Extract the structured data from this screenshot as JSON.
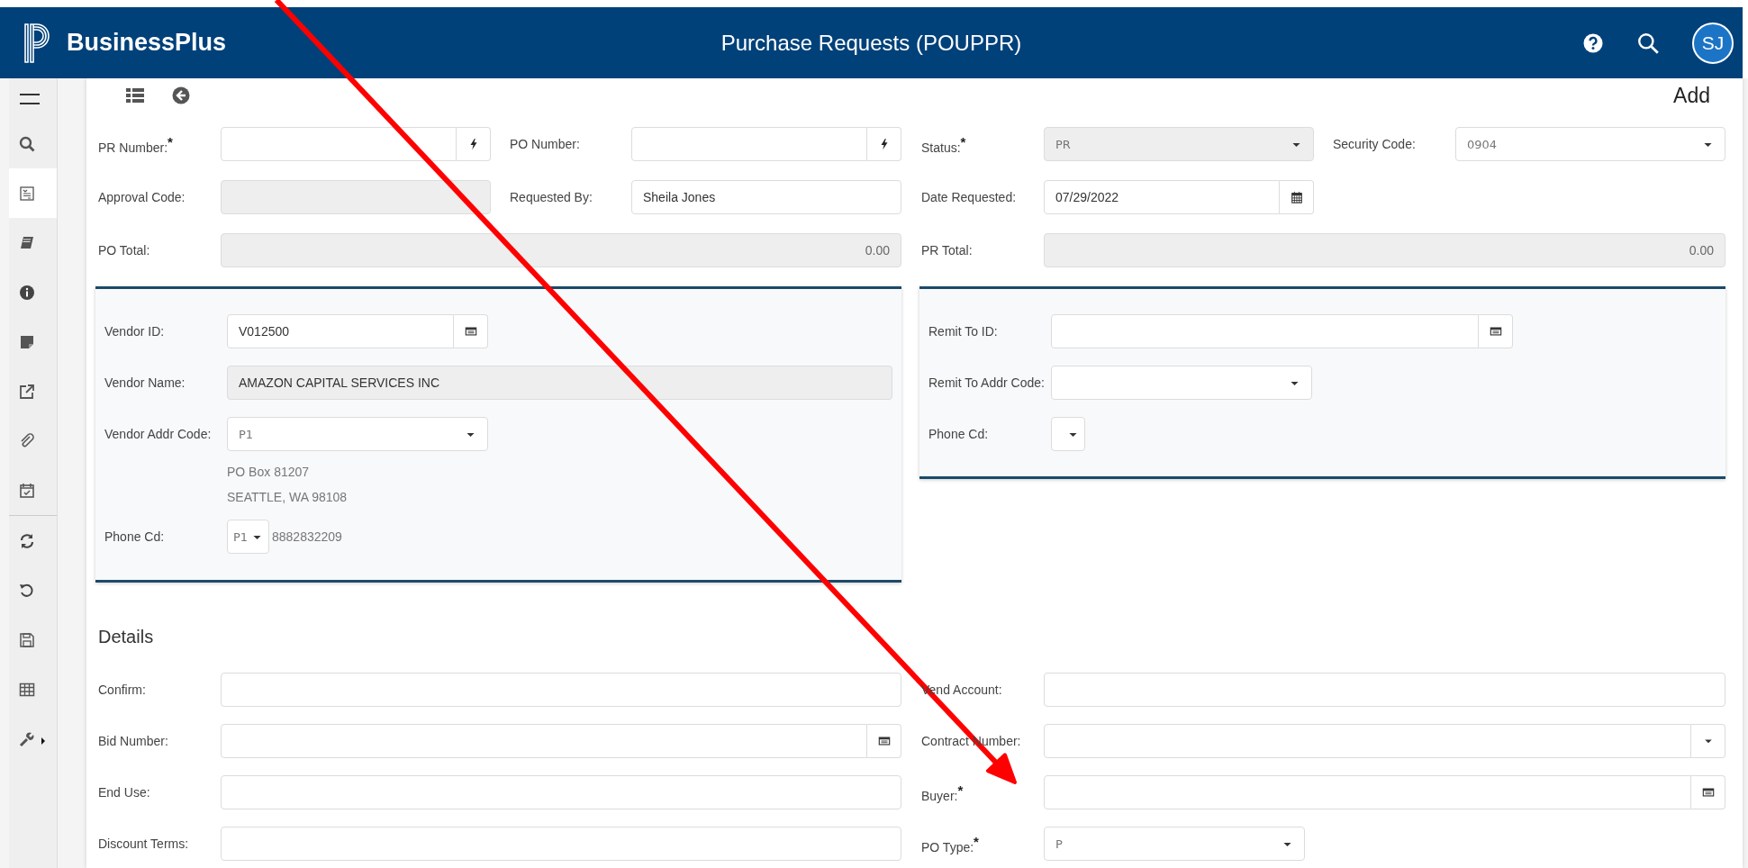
{
  "header": {
    "app_name": "BusinessPlus",
    "title": "Purchase Requests (POUPPR)",
    "avatar": "SJ"
  },
  "sidebar": {
    "groups": [
      [
        {
          "kind": "menu",
          "selected": false
        },
        {
          "kind": "search",
          "selected": false
        },
        {
          "kind": "form",
          "selected": true
        },
        {
          "kind": "book",
          "selected": false
        },
        {
          "kind": "info",
          "selected": false
        },
        {
          "kind": "note",
          "selected": false
        },
        {
          "kind": "external",
          "selected": false
        },
        {
          "kind": "attach",
          "selected": false
        },
        {
          "kind": "calendar",
          "selected": false
        }
      ],
      [
        {
          "kind": "refresh",
          "selected": false
        },
        {
          "kind": "undo",
          "selected": false
        },
        {
          "kind": "save",
          "selected": false
        },
        {
          "kind": "grid",
          "selected": false
        },
        {
          "kind": "tools",
          "selected": false
        }
      ]
    ]
  },
  "toolbar": {
    "mode": "Add"
  },
  "header_rows": [
    [
      {
        "label": "PR Number:$^{*}$",
        "kind": "lookup",
        "disabled": false
      },
      {
        "label": "PO Number:",
        "kind": "lookup",
        "disabled": false
      },
      {
        "label": "Status:$^{*}$",
        "kind": "select",
        "value": "PR",
        "disabled": true
      },
      {
        "label": "Security Code:",
        "kind": "select",
        "value": "0904",
        "disabled": false
      }
    ],
    [
      {
        "label": "Approval Code:",
        "kind": "text",
        "disabled": true
      },
      {
        "label": "Requested By:",
        "kind": "text",
        "value": "Sheila Jones",
        "disabled": false
      },
      {
        "label": "Date Requested:",
        "kind": "date",
        "value": "07/29/2022",
        "disabled": false
      }
    ],
    [
      {
        "label": "PO Total:",
        "kind": "total",
        "value": "0.00",
        "disabled": true
      },
      {
        "label": "PR Total:",
        "kind": "total",
        "value": "0.00",
        "disabled": true
      }
    ]
  ],
  "vendor_panel": [
    {
      "label": "Vendor ID:",
      "kind": "picker",
      "value": "V012500",
      "disabled": false
    },
    {
      "label": "Vendor Name:",
      "kind": "text",
      "value": "AMAZON CAPITAL SERVICES INC",
      "disabled": true
    },
    {
      "label": "Vendor Addr Code:",
      "kind": "select",
      "value": "P1",
      "disabled": false,
      "address_lines": [
        "PO Box 81207",
        "SEATTLE, WA 98108"
      ]
    },
    {
      "label": "Phone Cd:",
      "kind": "mini_select",
      "value": "P1",
      "disabled": false,
      "note": "8882832209"
    }
  ],
  "remit_panel": [
    {
      "label": "Remit To ID:",
      "kind": "picker",
      "disabled": false
    },
    {
      "label": "Remit To Addr Code:",
      "kind": "select",
      "disabled": false
    },
    {
      "label": "Phone Cd:",
      "kind": "mini_select",
      "disabled": false
    }
  ],
  "details": {
    "title": "Details",
    "rows": [
      [
        {
          "label": "Confirm:",
          "kind": "text",
          "disabled": false
        },
        {
          "label": "Vend Account:",
          "kind": "text",
          "disabled": false
        }
      ],
      [
        {
          "label": "Bid Number:",
          "kind": "picker",
          "disabled": false
        },
        {
          "label": "Contract Number:",
          "kind": "combo",
          "disabled": false
        }
      ],
      [
        {
          "label": "End Use:",
          "kind": "text",
          "disabled": false
        },
        {
          "label": "Buyer:$^{*}$",
          "kind": "picker",
          "disabled": false
        }
      ],
      [
        {
          "label": "Discount Terms:",
          "kind": "text",
          "disabled": false
        },
        {
          "label": "PO Type:$^{*}$",
          "kind": "select",
          "value": "P",
          "disabled": false
        }
      ]
    ]
  }
}
